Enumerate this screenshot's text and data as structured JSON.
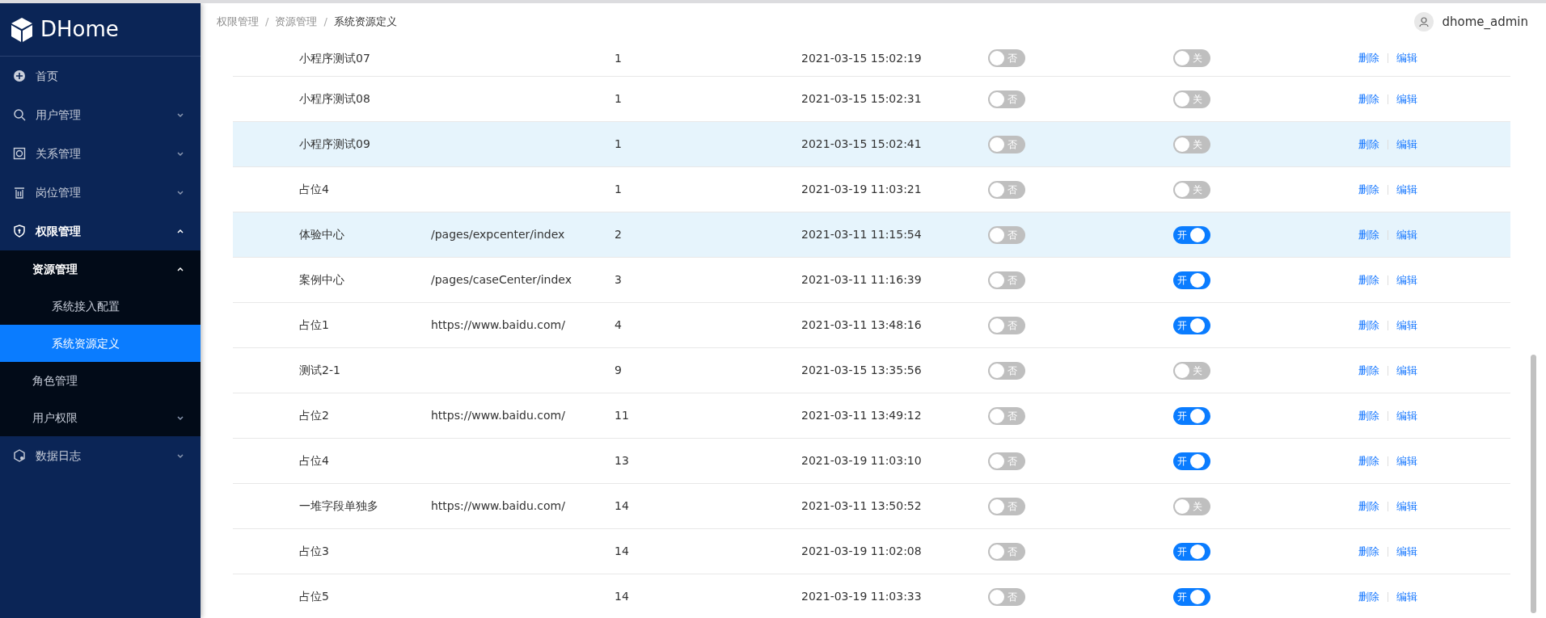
{
  "sidebar": {
    "logo": "DHome",
    "items": [
      {
        "label": "首页",
        "selected": false
      },
      {
        "label": "用户管理",
        "selected": false,
        "expanded": false
      },
      {
        "label": "关系管理",
        "selected": false,
        "expanded": false
      },
      {
        "label": "岗位管理",
        "selected": false,
        "expanded": false
      },
      {
        "label": "权限管理",
        "selected": false,
        "expanded": true,
        "children": [
          {
            "label": "资源管理",
            "selected": false,
            "expanded": true,
            "children": [
              {
                "label": "系统接入配置",
                "selected": false
              },
              {
                "label": "系统资源定义",
                "selected": true
              }
            ]
          },
          {
            "label": "角色管理",
            "selected": false
          },
          {
            "label": "用户权限",
            "selected": false,
            "expanded": false
          }
        ]
      },
      {
        "label": "数据日志",
        "selected": false,
        "expanded": false
      }
    ]
  },
  "breadcrumb": {
    "separator": "/",
    "items": [
      "权限管理",
      "资源管理",
      "系统资源定义"
    ]
  },
  "user": {
    "name": "dhome_admin"
  },
  "table": {
    "rows": [
      {
        "name": "小程序测试07",
        "order": "1",
        "time": "2021-03-15 15:02:19",
        "flag": {
          "on": false,
          "label": "否"
        },
        "switch": {
          "on": false,
          "label": "关"
        },
        "highlighted": false,
        "actions": [
          "删除",
          "编辑"
        ]
      },
      {
        "name": "小程序测试08",
        "order": "1",
        "time": "2021-03-15 15:02:31",
        "flag": {
          "on": false,
          "label": "否"
        },
        "switch": {
          "on": false,
          "label": "关"
        },
        "highlighted": false,
        "actions": [
          "删除",
          "编辑"
        ]
      },
      {
        "name": "小程序测试09",
        "order": "1",
        "time": "2021-03-15 15:02:41",
        "flag": {
          "on": false,
          "label": "否"
        },
        "switch": {
          "on": false,
          "label": "关"
        },
        "highlighted": true,
        "actions": [
          "删除",
          "编辑"
        ]
      },
      {
        "name": "占位4",
        "order": "1",
        "time": "2021-03-19 11:03:21",
        "flag": {
          "on": false,
          "label": "否"
        },
        "switch": {
          "on": false,
          "label": "关"
        },
        "highlighted": false,
        "actions": [
          "删除",
          "编辑"
        ]
      },
      {
        "name": "体验中心",
        "path": "/pages/expcenter/index",
        "order": "2",
        "time": "2021-03-11 11:15:54",
        "flag": {
          "on": false,
          "label": "否"
        },
        "switch": {
          "on": true,
          "label": "开"
        },
        "highlighted": true,
        "actions": [
          "删除",
          "编辑"
        ]
      },
      {
        "name": "案例中心",
        "path": "/pages/caseCenter/index",
        "order": "3",
        "time": "2021-03-11 11:16:39",
        "flag": {
          "on": false,
          "label": "否"
        },
        "switch": {
          "on": true,
          "label": "开"
        },
        "highlighted": false,
        "actions": [
          "删除",
          "编辑"
        ]
      },
      {
        "name": "占位1",
        "path": "https://www.baidu.com/",
        "order": "4",
        "time": "2021-03-11 13:48:16",
        "flag": {
          "on": false,
          "label": "否"
        },
        "switch": {
          "on": true,
          "label": "开"
        },
        "highlighted": false,
        "actions": [
          "删除",
          "编辑"
        ]
      },
      {
        "name": "测试2-1",
        "order": "9",
        "time": "2021-03-15 13:35:56",
        "flag": {
          "on": false,
          "label": "否"
        },
        "switch": {
          "on": false,
          "label": "关"
        },
        "highlighted": false,
        "actions": [
          "删除",
          "编辑"
        ]
      },
      {
        "name": "占位2",
        "path": "https://www.baidu.com/",
        "order": "11",
        "time": "2021-03-11 13:49:12",
        "flag": {
          "on": false,
          "label": "否"
        },
        "switch": {
          "on": true,
          "label": "开"
        },
        "highlighted": false,
        "actions": [
          "删除",
          "编辑"
        ]
      },
      {
        "name": "占位4",
        "order": "13",
        "time": "2021-03-19 11:03:10",
        "flag": {
          "on": false,
          "label": "否"
        },
        "switch": {
          "on": true,
          "label": "开"
        },
        "highlighted": false,
        "actions": [
          "删除",
          "编辑"
        ]
      },
      {
        "name": "一堆字段单独多",
        "path": "https://www.baidu.com/",
        "order": "14",
        "time": "2021-03-11 13:50:52",
        "flag": {
          "on": false,
          "label": "否"
        },
        "switch": {
          "on": false,
          "label": "关"
        },
        "highlighted": false,
        "actions": [
          "删除",
          "编辑"
        ]
      },
      {
        "name": "占位3",
        "order": "14",
        "time": "2021-03-19 11:02:08",
        "flag": {
          "on": false,
          "label": "否"
        },
        "switch": {
          "on": true,
          "label": "开"
        },
        "highlighted": false,
        "actions": [
          "删除",
          "编辑"
        ]
      },
      {
        "name": "占位5",
        "order": "14",
        "time": "2021-03-19 11:03:33",
        "flag": {
          "on": false,
          "label": "否"
        },
        "switch": {
          "on": true,
          "label": "开"
        },
        "highlighted": false,
        "actions": [
          "删除",
          "编辑"
        ]
      }
    ]
  }
}
